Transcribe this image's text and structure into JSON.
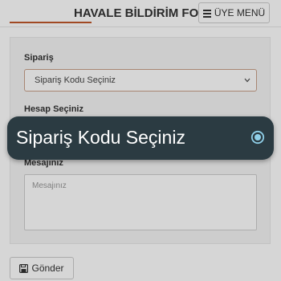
{
  "header": {
    "title": "HAVALE BİLDİRİM FORMU",
    "menu_label": "ÜYE MENÜ"
  },
  "form": {
    "order_label": "Sipariş",
    "order_select_value": "Sipariş Kodu Seçiniz",
    "account_label": "Hesap Seçiniz",
    "message_label": "Mesajınız",
    "message_placeholder": "Mesajınız",
    "submit_label": "Gönder"
  },
  "popup": {
    "option_label": "Sipariş Kodu Seçiniz",
    "selected": true
  },
  "colors": {
    "accent": "#c0572a",
    "popup_bg": "#2b3b42",
    "radio": "#8fcfe8"
  }
}
